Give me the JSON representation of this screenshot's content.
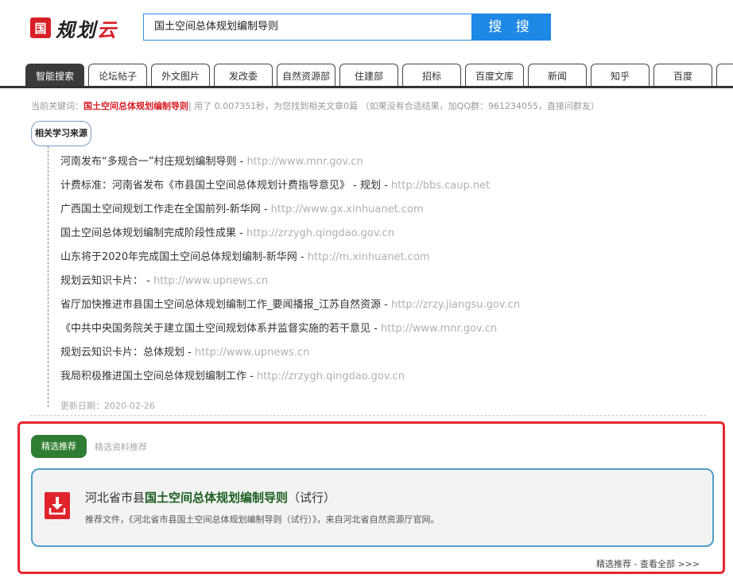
{
  "header": {
    "logo_mark": "国",
    "logo_text_a": "规划",
    "logo_text_b": "云",
    "search_value": "国土空间总体规划编制导则",
    "search_button": "搜 搜"
  },
  "tabs": [
    {
      "label": "智能搜索",
      "active": true
    },
    {
      "label": "论坛帖子"
    },
    {
      "label": "外文图片"
    },
    {
      "label": "发改委"
    },
    {
      "label": "自然资源部"
    },
    {
      "label": "住建部"
    },
    {
      "label": "招标"
    },
    {
      "label": "百度文库"
    },
    {
      "label": "新闻"
    },
    {
      "label": "知乎"
    },
    {
      "label": "百度"
    }
  ],
  "status": {
    "prefix": "当前关键词：",
    "keyword": "国土空间总体规划编制导则",
    "suffix": "| 用了 0.007351秒，为您找到相关文章0篇 （如果没有合适结果，加QQ群：961234055，直接问群友）"
  },
  "sources": {
    "badge": "相关学习来源",
    "items": [
      {
        "title": "河南发布“多规合一”村庄规划编制导则 - ",
        "url": "http://www.mnr.gov.cn"
      },
      {
        "title": "计费标准：河南省发布《市县国土空间总体规划计费指导意见》 - 规划 - ",
        "url": "http://bbs.caup.net"
      },
      {
        "title": "广西国土空间规划工作走在全国前列-新华网 - ",
        "url": "http://www.gx.xinhuanet.com"
      },
      {
        "title": "国土空间总体规划编制完成阶段性成果 - ",
        "url": "http://zrzygh.qingdao.gov.cn"
      },
      {
        "title": "山东将于2020年完成国土空间总体规划编制-新华网 - ",
        "url": "http://m.xinhuanet.com"
      },
      {
        "title": "规划云知识卡片：  - ",
        "url": "http://www.upnews.cn"
      },
      {
        "title": "省厅加快推进市县国土空间总体规划编制工作_要闻播报_江苏自然资源 - ",
        "url": "http://zrzy.jiangsu.gov.cn"
      },
      {
        "title": "《中共中央国务院关于建立国土空间规划体系并监督实施的若干意见 - ",
        "url": "http://www.mnr.gov.cn"
      },
      {
        "title": "规划云知识卡片：总体规划 - ",
        "url": "http://www.upnews.cn"
      },
      {
        "title": "我局积极推进国土空间总体规划编制工作 - ",
        "url": "http://zrzygh.qingdao.gov.cn"
      }
    ],
    "updated": "更新日期：2020-02-26"
  },
  "recommend": {
    "tab_active": "精选推荐",
    "tab_inactive": "精选资料推荐",
    "card": {
      "title_pre": "河北省市县",
      "title_hl": "国土空间总体规划编制导则",
      "title_post": "（试行）",
      "desc": "推荐文件，《河北省市县国土空间总体规划编制导则（试行）》，来自河北省自然资源厅官网。",
      "icon": "download-icon"
    },
    "more": "精选推荐 - 查看全部 >>>"
  },
  "colors": {
    "brand_red": "#d71f26",
    "search_blue": "#1e88e5",
    "rec_green": "#2e7d32",
    "frame_red": "#e8262c"
  }
}
